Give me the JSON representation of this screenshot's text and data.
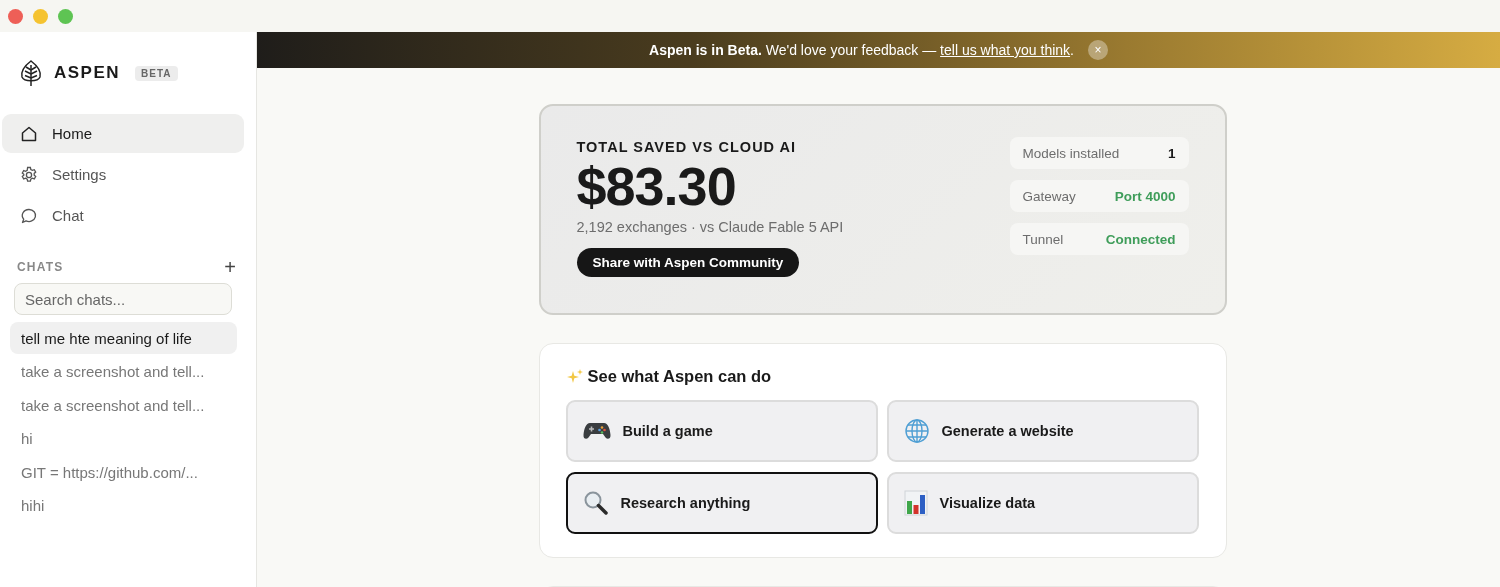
{
  "sidebar": {
    "brand": "ASPEN",
    "badge": "BETA",
    "nav": [
      {
        "label": "Home",
        "selected": true
      },
      {
        "label": "Settings",
        "selected": false
      },
      {
        "label": "Chat",
        "selected": false
      }
    ],
    "chats_heading": "CHATS",
    "add_button": "+",
    "search": {
      "placeholder": "Search chats..."
    },
    "chats": [
      {
        "title": "tell me hte meaning of life",
        "selected": true
      },
      {
        "title": "take a screenshot and tell...",
        "selected": false
      },
      {
        "title": "take a screenshot and tell...",
        "selected": false
      },
      {
        "title": "hi",
        "selected": false
      },
      {
        "title": "GIT = https://github.com/...",
        "selected": false
      },
      {
        "title": "hihi",
        "selected": false
      }
    ]
  },
  "banner": {
    "bold": "Aspen is in Beta.",
    "text": "We'd love your feedback —",
    "link": "tell us what you think",
    "end": ".",
    "close": "×"
  },
  "savings": {
    "heading": "TOTAL SAVED VS CLOUD AI",
    "amount": "$83.30",
    "detail": "2,192 exchanges · vs Claude Fable 5 API",
    "share_button": "Share with Aspen Community",
    "stats": [
      {
        "label": "Models installed",
        "value": "1",
        "good": false
      },
      {
        "label": "Gateway",
        "value": "Port 4000",
        "good": true
      },
      {
        "label": "Tunnel",
        "value": "Connected",
        "good": true
      }
    ]
  },
  "showcase": {
    "title": "See what Aspen can do",
    "actions": [
      {
        "label": "Build a game",
        "selected": false
      },
      {
        "label": "Generate a website",
        "selected": false
      },
      {
        "label": "Research anything",
        "selected": true
      },
      {
        "label": "Visualize data",
        "selected": false
      }
    ]
  }
}
